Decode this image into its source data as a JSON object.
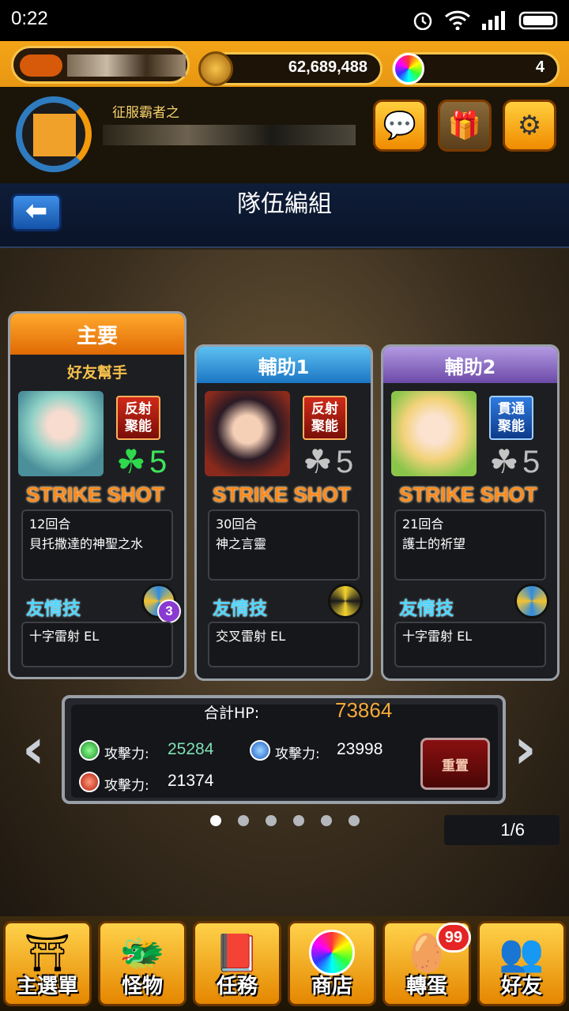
{
  "status_bar": {
    "time": "0:22"
  },
  "resources": {
    "coins": "62,689,488",
    "orbs": "4"
  },
  "profile": {
    "title": "征服霸者之"
  },
  "header": {
    "title": "隊伍編組"
  },
  "cards": [
    {
      "header": "主要",
      "sub": "好友幫手",
      "ability": [
        "反射",
        "聚能"
      ],
      "luck": "5",
      "strike_shot_label": "STRIKE SHOT",
      "ss_turns": "12回合",
      "ss_name": "貝托撒達的神聖之水",
      "friend_label": "友情技",
      "friend_skill": "十字雷射 EL",
      "friend_badge": "3"
    },
    {
      "header": "輔助1",
      "ability": [
        "反射",
        "聚能"
      ],
      "luck": "5",
      "strike_shot_label": "STRIKE SHOT",
      "ss_turns": "30回合",
      "ss_name": "神之言靈",
      "friend_label": "友情技",
      "friend_skill": "交叉雷射 EL"
    },
    {
      "header": "輔助2",
      "ability": [
        "貫通",
        "聚能"
      ],
      "luck": "5",
      "strike_shot_label": "STRIKE SHOT",
      "ss_turns": "21回合",
      "ss_name": "護士的祈望",
      "friend_label": "友情技",
      "friend_skill": "十字雷射 EL"
    }
  ],
  "summary": {
    "hp_label": "合計HP:",
    "hp_value": "73864",
    "attack_label": "攻擊力:",
    "attack_wood": "25284",
    "attack_water": "23998",
    "attack_fire": "21374",
    "reset_label": "重置"
  },
  "pager": {
    "text": "1/6",
    "dots": 6,
    "active": 0
  },
  "nav": [
    {
      "label": "主選單",
      "icon": "castle-gate-icon"
    },
    {
      "label": "怪物",
      "icon": "dragon-icon"
    },
    {
      "label": "任務",
      "icon": "book-icon"
    },
    {
      "label": "商店",
      "icon": "rainbow-orb-icon"
    },
    {
      "label": "轉蛋",
      "icon": "egg-icon"
    },
    {
      "label": "好友",
      "icon": "friends-icon"
    }
  ],
  "nav_badge": "99",
  "colors": {
    "accent": "#f3a417",
    "header_bg": "#0f1d38",
    "main_card": "#f48a10",
    "support1_card": "#2c8fd6",
    "support2_card": "#8e6bc4",
    "hp_value": "#f4a938",
    "wood_attack": "#7fe0b4"
  }
}
